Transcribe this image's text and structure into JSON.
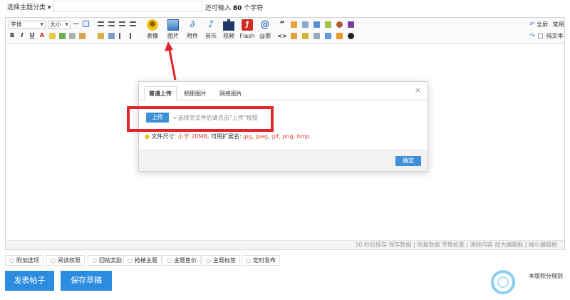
{
  "topbar": {
    "topic_select": "选择主题分类",
    "topic_caret": "▾",
    "remain_prefix": "还可输入",
    "remain_count": "80",
    "remain_suffix": "个字符"
  },
  "toolbar": {
    "font_select": "字体",
    "size_select": "大小",
    "format_buttons": [
      "B",
      "I",
      "U",
      "A"
    ],
    "big_buttons": [
      {
        "label": "表情",
        "icon": "smiley-icon"
      },
      {
        "label": "图片",
        "icon": "image-icon"
      },
      {
        "label": "附件",
        "icon": "paperclip-icon"
      },
      {
        "label": "音乐",
        "icon": "music-note-icon"
      },
      {
        "label": "视频",
        "icon": "video-icon"
      },
      {
        "label": "Flash",
        "icon": "flash-icon"
      },
      {
        "label": "@朋",
        "icon": "at-icon"
      }
    ],
    "quote_glyph": "“",
    "code_glyph": "<>",
    "fullscreen": "全屏",
    "common": "常用",
    "plain_text": "纯文本"
  },
  "status_bar": {
    "text": "30 秒后保存 保存数据 | 恢复数据    字数检查 | 清除内容    加大编辑框 | 缩小编辑框"
  },
  "dialog": {
    "tabs": [
      "普通上传",
      "相册图片",
      "网络图片"
    ],
    "close": "×",
    "upload_button": "上传",
    "upload_hint": "←选择完文件后请点击“上传”按钮",
    "limit_prefix": "文件尺寸: ",
    "limit_size": "小于 20MB",
    "limit_mid": ", 可用扩展名: ",
    "limit_ext": "jpg, jpeg, gif, png, bmp",
    "ok_button": "确定"
  },
  "options": [
    "附加选项",
    "阅读权限",
    "回帖奖励",
    "抢楼主题",
    "主题售价",
    "主题标签",
    "定时发布"
  ],
  "actions": {
    "submit": "发表帖子",
    "draft": "保存草稿",
    "rules": "本版积分规则"
  },
  "colors": {
    "accent": "#2b8ce0",
    "annotation": "#e0262a"
  }
}
